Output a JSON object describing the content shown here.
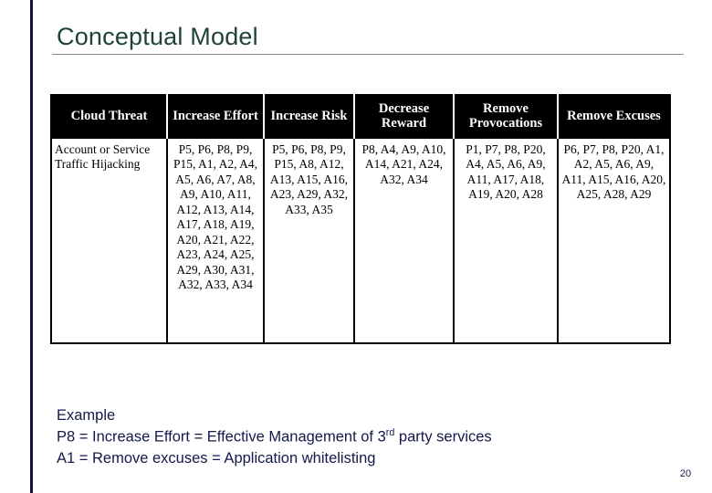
{
  "slide": {
    "title": "Conceptual Model",
    "page_number": "20",
    "accent_color": "#0d1040",
    "title_color": "#1f4435",
    "body_text_color": "#131a4a"
  },
  "table": {
    "headers": [
      "Cloud Threat",
      "Increase Effort",
      "Increase Risk",
      "Decrease Reward",
      "Remove Provocations",
      "Remove Excuses"
    ],
    "rows": [
      {
        "threat": "Account or Service Traffic Hijacking",
        "increase_effort": "P5, P6, P8, P9, P15, A1, A2, A4, A5, A6, A7, A8, A9, A10, A11, A12, A13, A14, A17, A18, A19, A20, A21, A22, A23, A24, A25, A29, A30, A31, A32, A33, A34",
        "increase_risk": "P5, P6, P8, P9, P15, A8, A12, A13, A15, A16, A23, A29, A32, A33, A35",
        "decrease_reward": "P8, A4, A9, A10, A14, A21, A24, A32, A34",
        "remove_provocations": "P1, P7, P8, P20, A4, A5, A6, A9, A11, A17, A18, A19, A20, A28",
        "remove_excuses": "P6, P7, P8, P20, A1, A2, A5, A6, A9, A11, A15, A16, A20, A25, A28, A29"
      }
    ]
  },
  "example": {
    "heading": "Example",
    "line1_prefix": "P8 = Increase Effort =  Effective Management of 3",
    "line1_sup": "rd",
    "line1_suffix": " party services",
    "line2": "A1 = Remove excuses = Application whitelisting"
  }
}
